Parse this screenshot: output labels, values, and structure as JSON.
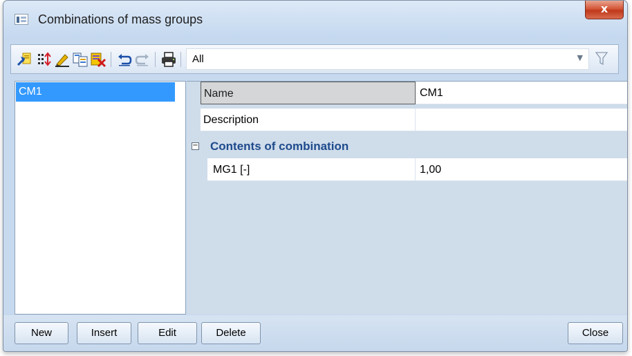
{
  "window": {
    "title": "Combinations of mass groups",
    "close_glyph": "x"
  },
  "toolbar": {
    "icons": [
      "new-record-icon",
      "insert-icon",
      "edit-icon",
      "copy-icon",
      "delete-icon",
      "undo-icon",
      "redo-icon",
      "print-icon"
    ],
    "filter_value": "All",
    "filter_icon": "filter-icon",
    "dropdown_glyph": "▼"
  },
  "list": {
    "items": [
      {
        "label": "CM1",
        "selected": true
      }
    ]
  },
  "properties": {
    "rows": [
      {
        "name": "Name",
        "value": "CM1"
      },
      {
        "name": "Description",
        "value": ""
      }
    ],
    "group": {
      "label": "Contents of combination",
      "collapse_glyph": "−",
      "rows": [
        {
          "name": "MG1 [-]",
          "value": "1,00"
        }
      ]
    }
  },
  "buttons": {
    "new": "New",
    "insert": "Insert",
    "edit": "Edit",
    "delete": "Delete",
    "close": "Close"
  },
  "colors": {
    "selection": "#3399ff",
    "group_label": "#1e4a8c",
    "close_button": "#c94a2d"
  }
}
